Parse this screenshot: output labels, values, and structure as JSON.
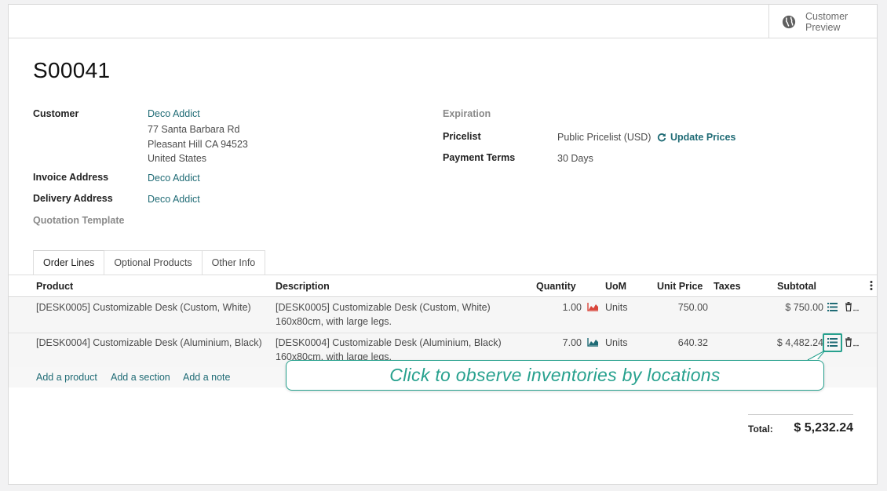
{
  "statusbar": {
    "preview_line1": "Customer",
    "preview_line2": "Preview"
  },
  "order": {
    "name": "S00041"
  },
  "customer": {
    "label": "Customer",
    "name": "Deco Addict",
    "address_line1": "77 Santa Barbara Rd",
    "address_line2": "Pleasant Hill CA 94523",
    "address_line3": "United States"
  },
  "invoice_address": {
    "label": "Invoice Address",
    "value": "Deco Addict"
  },
  "delivery_address": {
    "label": "Delivery Address",
    "value": "Deco Addict"
  },
  "quotation_template": {
    "label": "Quotation Template"
  },
  "expiration": {
    "label": "Expiration"
  },
  "pricelist": {
    "label": "Pricelist",
    "value": "Public Pricelist (USD)",
    "update_label": "Update Prices"
  },
  "payment_terms": {
    "label": "Payment Terms",
    "value": "30 Days"
  },
  "tabs": [
    {
      "label": "Order Lines"
    },
    {
      "label": "Optional Products"
    },
    {
      "label": "Other Info"
    }
  ],
  "table": {
    "headers": {
      "product": "Product",
      "description": "Description",
      "quantity": "Quantity",
      "uom": "UoM",
      "unit_price": "Unit Price",
      "taxes": "Taxes",
      "subtotal": "Subtotal"
    },
    "rows": [
      {
        "product": "[DESK0005] Customizable Desk (Custom, White)",
        "desc1": "[DESK0005] Customizable Desk (Custom, White)",
        "desc2": "160x80cm, with large legs.",
        "quantity": "1.00",
        "forecast_color": "#d9463b",
        "uom": "Units",
        "unit_price": "750.00",
        "subtotal": "$ 750.00"
      },
      {
        "product": "[DESK0004] Customizable Desk (Aluminium, Black)",
        "desc1": "[DESK0004] Customizable Desk (Aluminium, Black)",
        "desc2": "160x80cm, with large legs.",
        "quantity": "7.00",
        "forecast_color": "#1f6b75",
        "uom": "Units",
        "unit_price": "640.32",
        "subtotal": "$ 4,482.24"
      }
    ],
    "add_product": "Add a product",
    "add_section": "Add a section",
    "add_note": "Add a note"
  },
  "totals": {
    "label": "Total:",
    "value": "$ 5,232.24"
  },
  "tooltip": {
    "text": "Click to observe inventories by locations"
  },
  "colors": {
    "accent": "#1f6b75",
    "highlight": "#27a18e"
  }
}
